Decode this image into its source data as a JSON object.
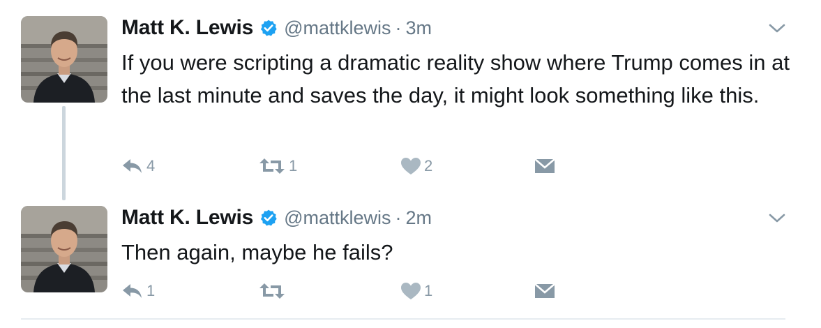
{
  "thread": {
    "tweets": [
      {
        "name": "Matt K. Lewis",
        "handle": "@mattklewis",
        "separator": "·",
        "time": "3m",
        "text": "If you were scripting a dramatic reality show where Trump comes in at the last minute and saves the day, it might look something like this.",
        "replies": "4",
        "retweets": "1",
        "likes": "2"
      },
      {
        "name": "Matt K. Lewis",
        "handle": "@mattklewis",
        "separator": "·",
        "time": "2m",
        "text": "Then again, maybe he fails?",
        "replies": "1",
        "retweets": "",
        "likes": "1"
      }
    ]
  },
  "icons": {
    "verified": "verified-badge-icon",
    "caret": "chevron-down-icon",
    "reply": "reply-icon",
    "retweet": "retweet-icon",
    "like": "heart-icon",
    "dm": "envelope-icon"
  },
  "colors": {
    "text": "#14171a",
    "secondary": "#657786",
    "action_gray": "#8899a6",
    "verified_blue": "#1da1f2",
    "thread_line": "#ccd6dd"
  }
}
